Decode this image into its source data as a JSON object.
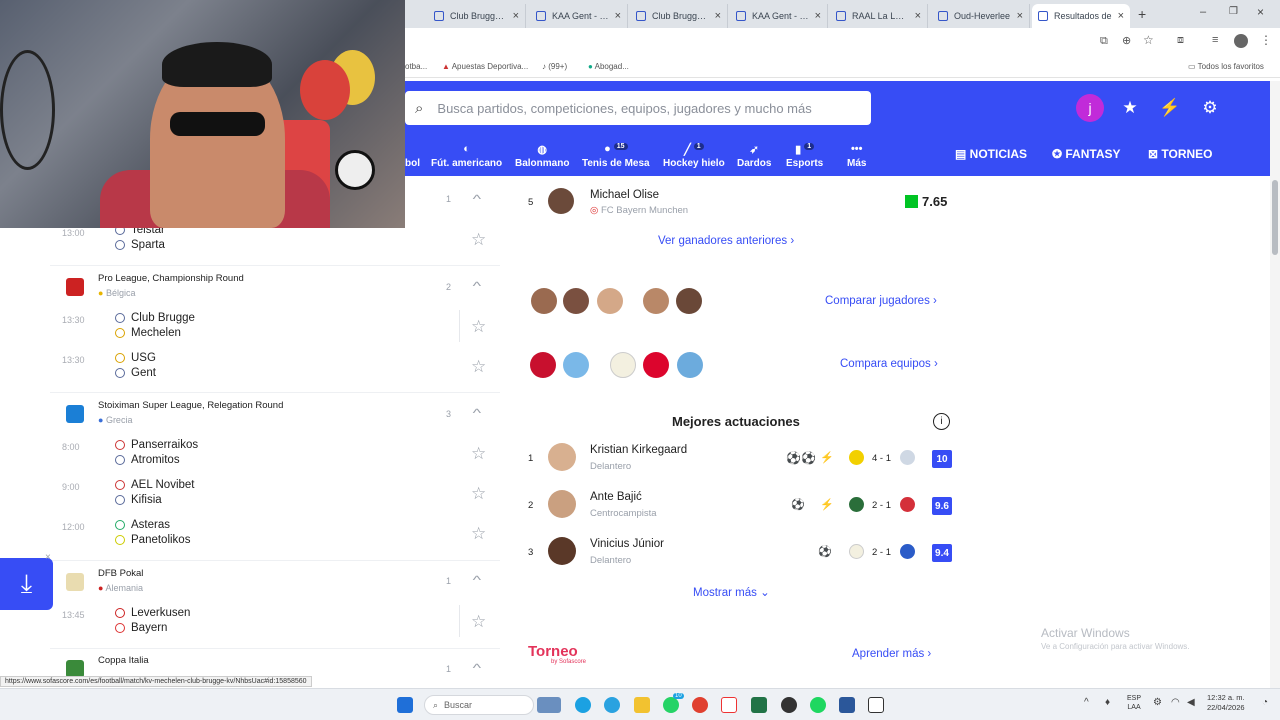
{
  "tabs": [
    {
      "label": "Club Brugge KV",
      "active": false
    },
    {
      "label": "KAA Gent - KV",
      "active": false
    },
    {
      "label": "Club Brugge KV",
      "active": false
    },
    {
      "label": "KAA Gent - KV",
      "active": false
    },
    {
      "label": "RAAL La Louvière",
      "active": false
    },
    {
      "label": "Oud-Heverlee",
      "active": false
    },
    {
      "label": "Resultados de",
      "active": true
    }
  ],
  "bookmarks": {
    "item1": "otba...",
    "item2": "Apuestas Deportiva...",
    "item3": "(99+)",
    "item4": "Abogad...",
    "all_favorites": "Todos los favoritos"
  },
  "header": {
    "search_placeholder": "Busca partidos, competiciones, equipos, jugadores y mucho más",
    "avatar_letter": "j",
    "sports": [
      {
        "label": "bol",
        "badge": ""
      },
      {
        "label": "Fút. americano",
        "badge": ""
      },
      {
        "label": "Balonmano",
        "badge": ""
      },
      {
        "label": "Tenis de Mesa",
        "badge": "15"
      },
      {
        "label": "Hockey hielo",
        "badge": "1"
      },
      {
        "label": "Dardos",
        "badge": ""
      },
      {
        "label": "Esports",
        "badge": "1"
      },
      {
        "label": "Más",
        "badge": ""
      }
    ],
    "noticias": "NOTICIAS",
    "fantasy": "FANTASY",
    "torneo": "TORNEO"
  },
  "left": {
    "top_league_count": "1",
    "match0": {
      "time": "13:00",
      "home": "Telstar",
      "away": "Sparta"
    },
    "league1": {
      "name": "Pro League, Championship Round",
      "country": "Bélgica",
      "count": "2"
    },
    "match1": {
      "time": "13:30",
      "home": "Club Brugge",
      "away": "Mechelen"
    },
    "match2": {
      "time": "13:30",
      "home": "USG",
      "away": "Gent"
    },
    "league2": {
      "name": "Stoiximan Super League, Relegation Round",
      "country": "Grecia",
      "count": "3"
    },
    "match3": {
      "time": "8:00",
      "home": "Panserraikos",
      "away": "Atromitos"
    },
    "match4": {
      "time": "9:00",
      "home": "AEL Novibet",
      "away": "Kifisia"
    },
    "match5": {
      "time": "12:00",
      "home": "Asteras",
      "away": "Panetolikos"
    },
    "league3": {
      "name": "DFB Pokal",
      "country": "Alemania",
      "count": "1"
    },
    "match6": {
      "time": "13:45",
      "home": "Leverkusen",
      "away": "Bayern"
    },
    "league4": {
      "name": "Coppa Italia",
      "count": "1"
    }
  },
  "right": {
    "prev_winner": {
      "rank": "5",
      "name": "Michael Olise",
      "team": "FC Bayern Munchen",
      "rating": "7.65"
    },
    "ver_ganadores": "Ver ganadores anteriores",
    "comparar_jugadores": "Comparar jugadores",
    "compara_equipos": "Compara equipos",
    "mejores_title": "Mejores actuaciones",
    "performances": [
      {
        "rank": "1",
        "name": "Kristian Kirkegaard",
        "position": "Delantero",
        "score": "4 - 1",
        "rating": "10"
      },
      {
        "rank": "2",
        "name": "Ante Bajić",
        "position": "Centrocampista",
        "score": "2 - 1",
        "rating": "9.6"
      },
      {
        "rank": "3",
        "name": "Vinicius Júnior",
        "position": "Delantero",
        "score": "2 - 1",
        "rating": "9.4"
      }
    ],
    "mostrar_mas": "Mostrar más",
    "torneo_logo": "Torneo",
    "torneo_by": "by Sofascore",
    "aprender_mas": "Aprender más"
  },
  "status_url": "https://www.sofascore.com/es/football/match/kv-mechelen-club-brugge-kv/NhbsUac#id:15858560",
  "activate_windows": {
    "title": "Activar Windows",
    "subtitle": "Ve a Configuración para activar Windows."
  },
  "taskbar": {
    "search": "Buscar",
    "lang1": "ESP",
    "lang2": "LAA",
    "time": "12:32 a. m.",
    "date": "22/04/2026",
    "notif": "10"
  },
  "colors": {
    "brand": "#374df5",
    "rating_green": "#00c424"
  }
}
